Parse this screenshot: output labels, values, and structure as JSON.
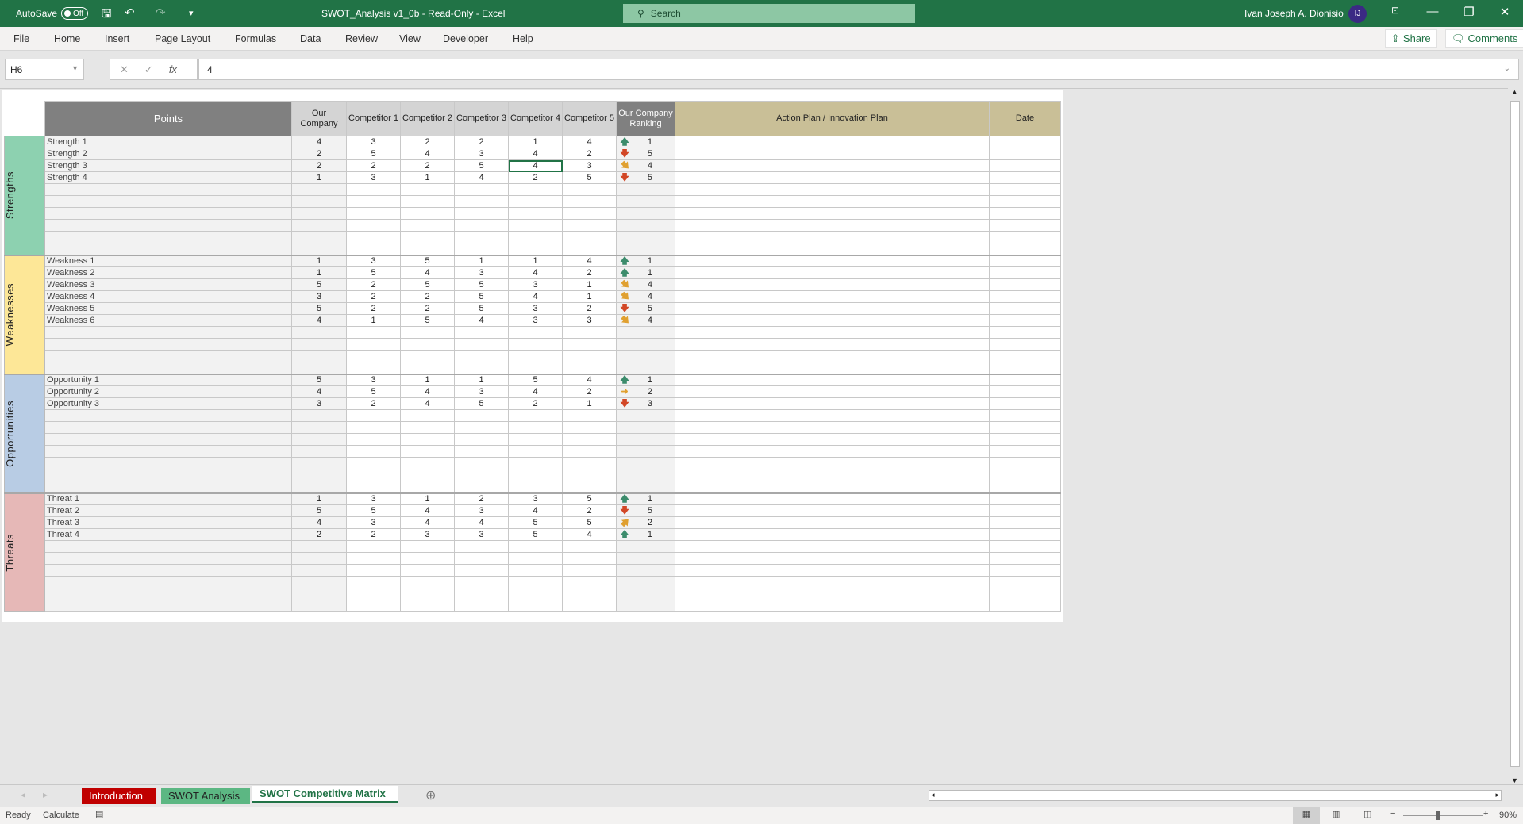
{
  "titlebar": {
    "autosave": "AutoSave",
    "toggle": "Off",
    "title": "SWOT_Analysis v1_0b  -  Read-Only  -  Excel",
    "search": "Search",
    "user": "Ivan Joseph A. Dionisio",
    "initials": "IJ"
  },
  "ribbon": {
    "tabs": [
      "File",
      "Home",
      "Insert",
      "Page Layout",
      "Formulas",
      "Data",
      "Review",
      "View",
      "Developer",
      "Help"
    ],
    "share": "Share",
    "comments": "Comments"
  },
  "formula": {
    "cell": "H6",
    "value": "4",
    "fx": "fx"
  },
  "table": {
    "headers": {
      "points": "Points",
      "our": "Our Company",
      "c1": "Competitor 1",
      "c2": "Competitor 2",
      "c3": "Competitor 3",
      "c4": "Competitor 4",
      "c5": "Competitor 5",
      "rank": "Our Company Ranking",
      "plan": "Action Plan  /  Innovation Plan",
      "date": "Date"
    },
    "sections": [
      {
        "name": "Strengths",
        "color": "#8dd1b0",
        "rows": [
          {
            "point": "Strength 1",
            "v": [
              4,
              3,
              2,
              2,
              1,
              4
            ],
            "rank": 1,
            "icon": "arrow-up"
          },
          {
            "point": "Strength 2",
            "v": [
              2,
              5,
              4,
              3,
              4,
              2
            ],
            "rank": 5,
            "icon": "arrow-down"
          },
          {
            "point": "Strength 3",
            "v": [
              2,
              2,
              2,
              5,
              4,
              3
            ],
            "rank": 4,
            "icon": "arrow-down-right"
          },
          {
            "point": "Strength 4",
            "v": [
              1,
              3,
              1,
              4,
              2,
              5
            ],
            "rank": 5,
            "icon": "arrow-down"
          }
        ]
      },
      {
        "name": "Weaknesses",
        "color": "#fde797",
        "rows": [
          {
            "point": "Weakness 1",
            "v": [
              1,
              3,
              5,
              1,
              1,
              4
            ],
            "rank": 1,
            "icon": "arrow-up"
          },
          {
            "point": "Weakness 2",
            "v": [
              1,
              5,
              4,
              3,
              4,
              2
            ],
            "rank": 1,
            "icon": "arrow-up"
          },
          {
            "point": "Weakness 3",
            "v": [
              5,
              2,
              5,
              5,
              3,
              1
            ],
            "rank": 4,
            "icon": "arrow-down-right"
          },
          {
            "point": "Weakness 4",
            "v": [
              3,
              2,
              2,
              5,
              4,
              1
            ],
            "rank": 4,
            "icon": "arrow-down-right"
          },
          {
            "point": "Weakness 5",
            "v": [
              5,
              2,
              2,
              5,
              3,
              2
            ],
            "rank": 5,
            "icon": "arrow-down"
          },
          {
            "point": "Weakness 6",
            "v": [
              4,
              1,
              5,
              4,
              3,
              3
            ],
            "rank": 4,
            "icon": "arrow-down-right"
          }
        ]
      },
      {
        "name": "Opportunities",
        "color": "#b8cce4",
        "rows": [
          {
            "point": "Opportunity 1",
            "v": [
              5,
              3,
              1,
              1,
              5,
              4
            ],
            "rank": 1,
            "icon": "arrow-up"
          },
          {
            "point": "Opportunity 2",
            "v": [
              4,
              5,
              4,
              3,
              4,
              2
            ],
            "rank": 2,
            "icon": "arrow-right"
          },
          {
            "point": "Opportunity 3",
            "v": [
              3,
              2,
              4,
              5,
              2,
              1
            ],
            "rank": 3,
            "icon": "arrow-down"
          }
        ]
      },
      {
        "name": "Threats",
        "color": "#e6b8b7",
        "rows": [
          {
            "point": "Threat 1",
            "v": [
              1,
              3,
              1,
              2,
              3,
              5
            ],
            "rank": 1,
            "icon": "arrow-up"
          },
          {
            "point": "Threat 2",
            "v": [
              5,
              5,
              4,
              3,
              4,
              2
            ],
            "rank": 5,
            "icon": "arrow-down"
          },
          {
            "point": "Threat 3",
            "v": [
              4,
              3,
              4,
              4,
              5,
              5
            ],
            "rank": 2,
            "icon": "arrow-up-right"
          },
          {
            "point": "Threat 4",
            "v": [
              2,
              2,
              3,
              3,
              5,
              4
            ],
            "rank": 1,
            "icon": "arrow-up"
          }
        ]
      }
    ]
  },
  "sheets": [
    {
      "label": "Introduction",
      "color": "#c00000"
    },
    {
      "label": "SWOT Analysis",
      "color": "#5cb783"
    },
    {
      "label": "SWOT Competitive Matrix",
      "active": true
    }
  ],
  "status": {
    "ready": "Ready",
    "calculate": "Calculate",
    "zoom": "90%"
  }
}
